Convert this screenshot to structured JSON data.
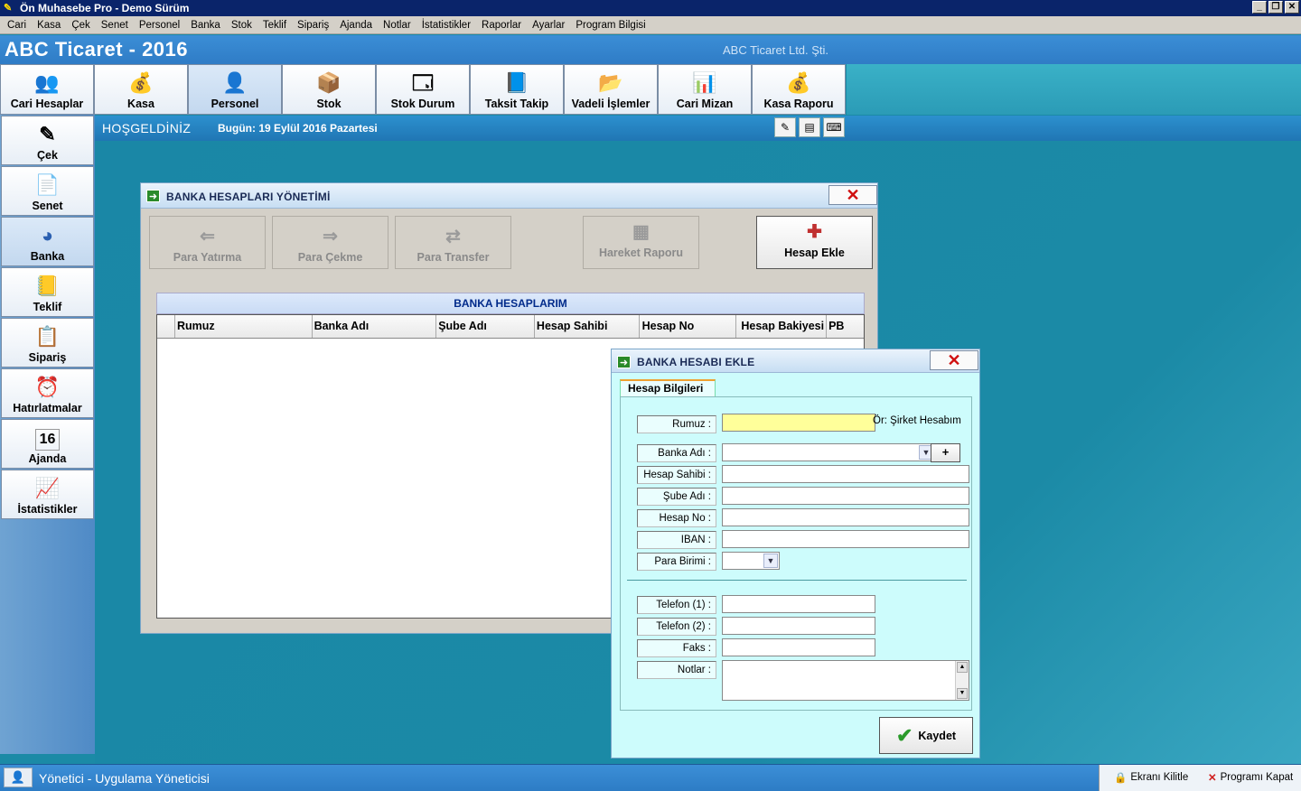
{
  "window": {
    "title": "Ön Muhasebe Pro - Demo Sürüm",
    "buttons": [
      "_",
      "❐",
      "✕"
    ]
  },
  "menu": [
    "Cari",
    "Kasa",
    "Çek",
    "Senet",
    "Personel",
    "Banka",
    "Stok",
    "Teklif",
    "Sipariş",
    "Ajanda",
    "Notlar",
    "İstatistikler",
    "Raporlar",
    "Ayarlar",
    "Program Bilgisi"
  ],
  "header": {
    "company_title": "ABC Ticaret - 2016",
    "company_legal": "ABC Ticaret Ltd. Şti."
  },
  "toolbar": [
    {
      "label": "Cari Hesaplar",
      "icon": "users-icon",
      "glyph": "👥"
    },
    {
      "label": "Kasa",
      "icon": "coins-icon",
      "glyph": "💰"
    },
    {
      "label": "Personel",
      "icon": "person-icon",
      "glyph": "👤"
    },
    {
      "label": "Stok",
      "icon": "box-icon",
      "glyph": "📦"
    },
    {
      "label": "Stok Durum",
      "icon": "window-icon",
      "glyph": "🗔"
    },
    {
      "label": "Taksit Takip",
      "icon": "calendar-icon",
      "glyph": "📘"
    },
    {
      "label": "Vadeli İşlemler",
      "icon": "folder-icon",
      "glyph": "📂"
    },
    {
      "label": "Cari Mizan",
      "icon": "chart-icon",
      "glyph": "📊"
    },
    {
      "label": "Kasa Raporu",
      "icon": "money-bag-icon",
      "glyph": "💰"
    }
  ],
  "welcome": {
    "hello": "HOŞGELDİNİZ",
    "date": "Bugün: 19 Eylül 2016 Pazartesi"
  },
  "sidebar": [
    {
      "label": "Çek",
      "icon": "check-icon",
      "glyph": "✎"
    },
    {
      "label": "Senet",
      "icon": "document-icon",
      "glyph": "📄"
    },
    {
      "label": "Banka",
      "icon": "pie-icon",
      "glyph": "◕"
    },
    {
      "label": "Teklif",
      "icon": "notebook-icon",
      "glyph": "📒"
    },
    {
      "label": "Sipariş",
      "icon": "order-icon",
      "glyph": "📋"
    },
    {
      "label": "Hatırlatmalar",
      "icon": "alarm-clock-icon",
      "glyph": "⏰"
    },
    {
      "label": "Ajanda",
      "icon": "agenda-icon",
      "glyph": "16"
    },
    {
      "label": "İstatistikler",
      "icon": "statistics-icon",
      "glyph": "📈"
    }
  ],
  "bank_window": {
    "title": "BANKA HESAPLARI YÖNETİMİ",
    "actions": [
      {
        "label": "Para Yatırma",
        "glyph": "⇐"
      },
      {
        "label": "Para Çekme",
        "glyph": "⇒"
      },
      {
        "label": "Para Transfer",
        "glyph": "⇄"
      },
      {
        "label": "Hareket Raporu",
        "glyph": "▦"
      },
      {
        "label": "Hesap Ekle",
        "glyph": "✚"
      }
    ],
    "grid_title": "BANKA HESAPLARIM",
    "columns": [
      "Rumuz",
      "Banka Adı",
      "Şube Adı",
      "Hesap Sahibi",
      "Hesap No",
      "Hesap Bakiyesi",
      "PB"
    ]
  },
  "add_dialog": {
    "title": "BANKA HESABI EKLE",
    "tab": "Hesap Bilgileri",
    "hint": "Ör: Şirket Hesabım",
    "fields": {
      "rumuz": "Rumuz :",
      "banka_adi": "Banka Adı :",
      "hesap_sahibi": "Hesap Sahibi :",
      "sube_adi": "Şube Adı :",
      "hesap_no": "Hesap No :",
      "iban": "IBAN :",
      "para_birimi": "Para Birimi :",
      "telefon1": "Telefon (1) :",
      "telefon2": "Telefon (2) :",
      "faks": "Faks :",
      "notlar": "Notlar :"
    },
    "plus_label": "+",
    "save_label": "Kaydet"
  },
  "status": {
    "user": "Yönetici - Uygulama Yöneticisi",
    "lock_label": "Ekranı Kilitle",
    "close_label": "Programı Kapat"
  }
}
